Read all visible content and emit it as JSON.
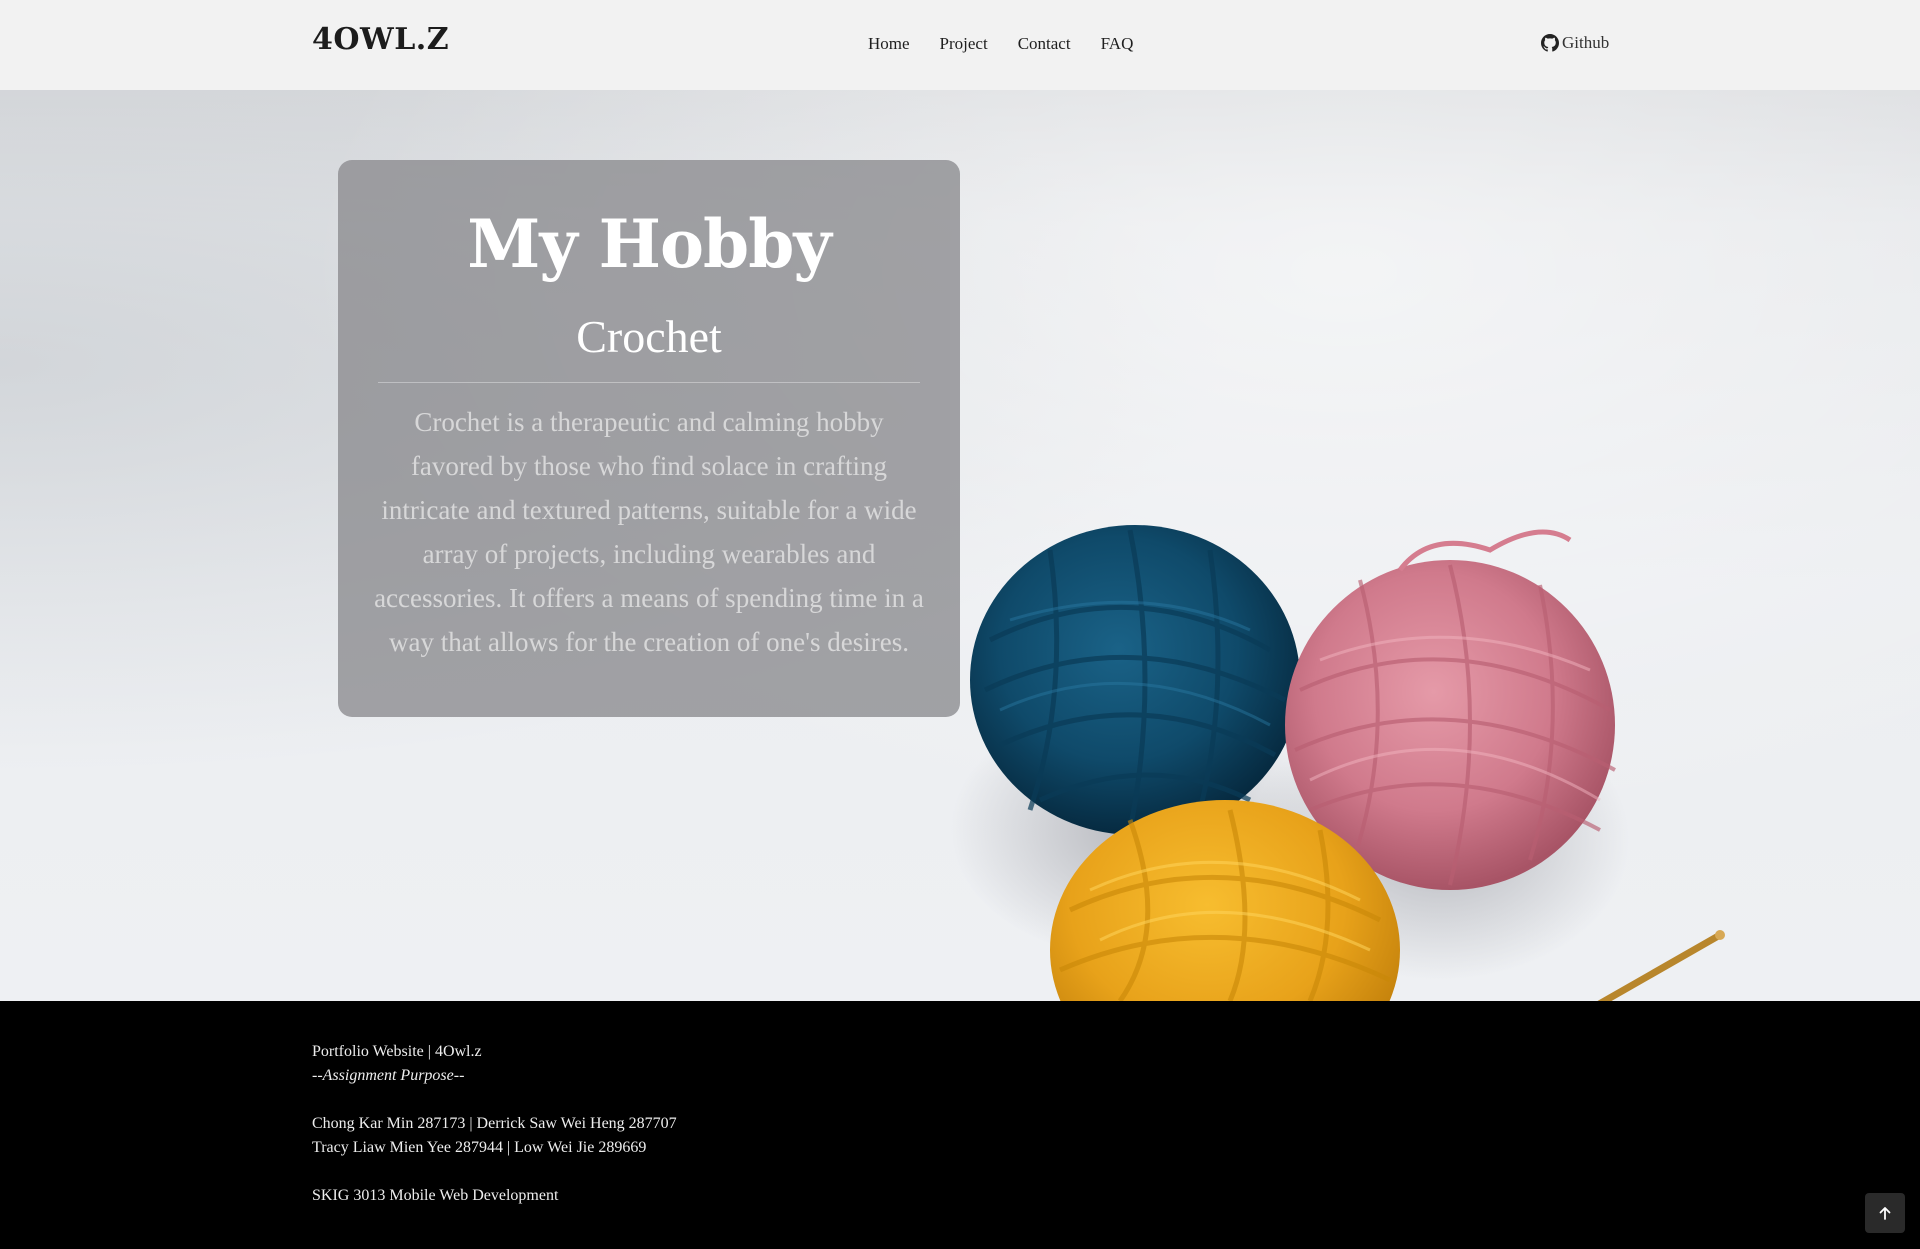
{
  "navbar": {
    "brand": "4OWL.Z",
    "links": [
      "Home",
      "Project",
      "Contact",
      "FAQ"
    ],
    "github_label": "Github"
  },
  "hero": {
    "title": "My Hobby",
    "subtitle": "Crochet",
    "description": "Crochet is a therapeutic and calming hobby favored by those who find solace in crafting intricate and textured patterns, suitable for a wide array of projects, including wearables and accessories. It offers a means of spending time in a way that allows for the creation of one's desires.",
    "image_subject": "yarn balls with crochet hook",
    "colors": {
      "yarn_blue": "#124a6b",
      "yarn_pink": "#d57d8f",
      "yarn_yellow": "#e8a21a",
      "hook": "#b8862c"
    }
  },
  "footer": {
    "line1": "Portfolio Website | 4Owl.z",
    "line2": "--Assignment Purpose--",
    "line3": "Chong Kar Min 287173 | Derrick Saw Wei Heng 287707",
    "line4": "Tracy Liaw Mien Yee 287944 | Low Wei Jie 289669",
    "line5": "SKIG 3013 Mobile Web Development"
  },
  "back_to_top_icon": "arrow-up-icon"
}
